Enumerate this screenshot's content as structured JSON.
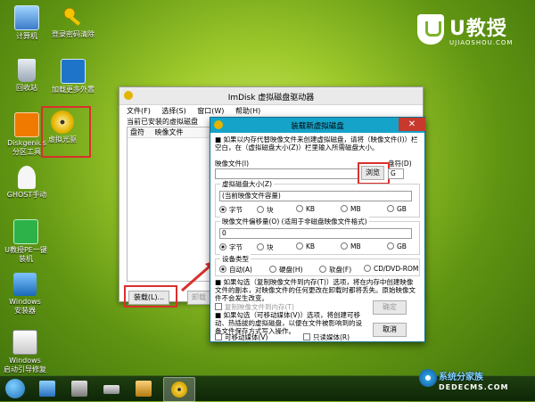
{
  "desktop": {
    "icons": [
      {
        "label": "计算机",
        "icon": "computer-icon"
      },
      {
        "label": "登录密码清除",
        "icon": "key-icon"
      },
      {
        "label": "回收站",
        "icon": "recycle-bin-icon"
      },
      {
        "label": "加载更多外置",
        "icon": "load-more-icon"
      },
      {
        "label": "Diskgenius\n分区工具",
        "icon": "diskgenius-icon"
      },
      {
        "label": "虚拟光驱",
        "icon": "virtual-cd-icon"
      },
      {
        "label": "GHOST手动",
        "icon": "ghost-icon"
      },
      {
        "label": "U教授PE一键\n装机",
        "icon": "installer-icon"
      },
      {
        "label": "Windows\n安装器",
        "icon": "windows-installer-icon"
      },
      {
        "label": "Windows\n启动引导修复",
        "icon": "boot-repair-icon"
      }
    ]
  },
  "logo": {
    "brand": "U教授",
    "url": "UJIAOSHOU.COM"
  },
  "main_window": {
    "title": "ImDisk 虚拟磁盘驱动器",
    "menu": [
      "文件(F)",
      "选择(S)",
      "窗口(W)",
      "帮助(H)"
    ],
    "list_caption": "当前已安装的虚拟磁盘",
    "columns": [
      "盘符",
      "映像文件"
    ],
    "load_button": "装载(L)...",
    "unload_button": "卸载"
  },
  "dialog": {
    "title": "装载新虚拟磁盘",
    "close": "✕",
    "note_top": "如果以内存代替映像文件来创建虚拟磁盘，请将（映像文件(I)）栏空白，在（虚拟磁盘大小(Z)）栏里输入所需磁盘大小。",
    "image_file_label": "映像文件(I)",
    "drive_letter_label": "盘符(D)",
    "drive_letter_value": "G",
    "browse_button": "浏览",
    "size_group": {
      "title": "虚拟磁盘大小(Z)",
      "value": "(当前映像文件容量)",
      "units": [
        "字节",
        "块",
        "KB",
        "MB",
        "GB"
      ],
      "selected": "字节"
    },
    "offset_group": {
      "title": "映像文件偏移量(O) (适用于非磁盘映像文件格式)",
      "value": "0",
      "units": [
        "字节",
        "块",
        "KB",
        "MB",
        "GB"
      ],
      "selected": "字节"
    },
    "device_group": {
      "title": "设备类型",
      "options": [
        "自动(A)",
        "硬盘(H)",
        "软盘(F)",
        "CD/DVD-ROM"
      ],
      "selected": "自动(A)"
    },
    "note_mid": "如果勾选（复制映像文件到内存(T)）选项，将在内存中创建映像文件的副本，对映像文件的任何更改在卸载时都将丢失。原始映像文件不会发生改变。",
    "copy_to_memory_label": "复制映像文件到内存(T)",
    "ok_button": "确定",
    "note_bottom": "如果勾选（可移动媒体(V)）选项，将创建可移动、热插拔的虚拟磁盘，以便在文件被影响到的设备文件保存方式写入操作。",
    "cancel_button": "取消",
    "removable_label": "可移动媒体(V)",
    "readonly_label": "只读媒体(R)"
  },
  "taskbar": {
    "items": [
      "start-icon",
      "desktop-icon",
      "printer-icon",
      "drive-icon",
      "tool-icon",
      "imdisk-icon"
    ],
    "watermark_line1": "系统分家族",
    "watermark_line2": "DEDECMS.COM"
  },
  "colors": {
    "dialog_title": "#16a3c9",
    "close": "#c7392d",
    "highlight": "#d9302c"
  }
}
